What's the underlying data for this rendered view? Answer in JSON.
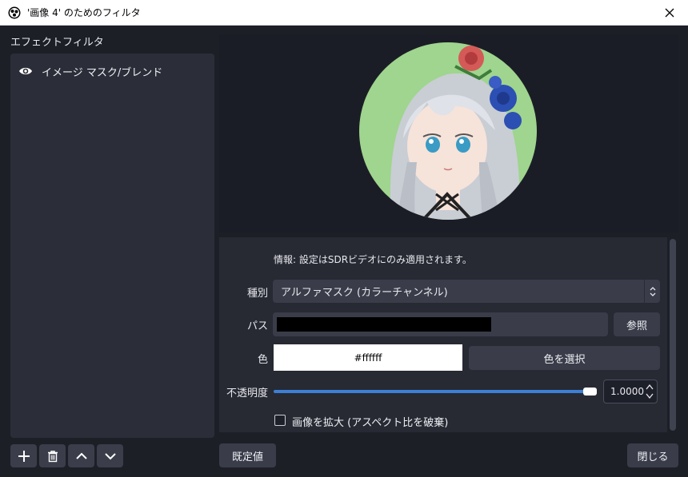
{
  "window": {
    "title": "'画像 4' のためのフィルタ"
  },
  "filters_panel": {
    "heading": "エフェクトフィルタ",
    "items": [
      {
        "label": "イメージ マスク/ブレンド",
        "visible": true
      }
    ],
    "buttons": [
      "add-icon",
      "trash-icon",
      "chevron-up-icon",
      "chevron-down-icon"
    ]
  },
  "properties": {
    "info": "情報: 設定はSDRビデオにのみ適用されます。",
    "type_label": "種別",
    "type_value": "アルファマスク (カラーチャンネル)",
    "path_label": "パス",
    "browse_label": "参照",
    "color_label": "色",
    "color_value": "#ffffff",
    "select_color_label": "色を選択",
    "opacity_label": "不透明度",
    "opacity_value": "1.0000",
    "opacity_fraction": 1.0,
    "stretch_label": "画像を拡大 (アスペクト比を破棄)",
    "stretch_checked": false
  },
  "footer": {
    "defaults_label": "既定値",
    "close_label": "閉じる"
  },
  "colors": {
    "background": "#1d1f27",
    "panel": "#2b2e38",
    "accent": "#3d7fd6",
    "avatar_bg": "#9fd58e"
  }
}
